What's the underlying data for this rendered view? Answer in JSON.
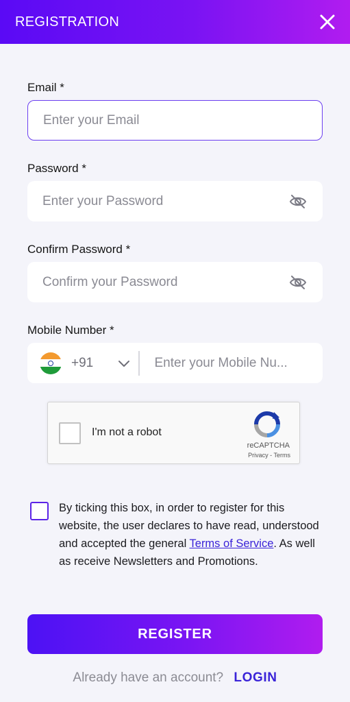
{
  "header": {
    "title": "REGISTRATION",
    "close_icon": "close-icon"
  },
  "form": {
    "email": {
      "label": "Email *",
      "placeholder": "Enter your Email",
      "value": ""
    },
    "password": {
      "label": "Password *",
      "placeholder": "Enter your Password",
      "value": "",
      "icon": "eye-off-icon"
    },
    "confirm_password": {
      "label": "Confirm Password *",
      "placeholder": "Confirm your Password",
      "value": "",
      "icon": "eye-off-icon"
    },
    "mobile": {
      "label": "Mobile Number *",
      "country_flag": "india-flag-icon",
      "dial_code": "+91",
      "placeholder": "Enter your Mobile Nu...",
      "value": ""
    }
  },
  "recaptcha": {
    "label": "I'm not a robot",
    "brand": "reCAPTCHA",
    "links": "Privacy - Terms"
  },
  "consent": {
    "text_before": "By ticking this box, in order to register for this website, the user declares to have read, understood and accepted the general ",
    "link_text": "Terms of Service",
    "text_after": ". As well as receive Newsletters and Promotions."
  },
  "actions": {
    "register_label": "REGISTER",
    "login_prompt": "Already have an account?",
    "login_label": "LOGIN"
  },
  "colors": {
    "accent": "#5b23e6",
    "link": "#3a23d8",
    "gradient_start": "#4c12f4",
    "gradient_end": "#b01cef"
  }
}
